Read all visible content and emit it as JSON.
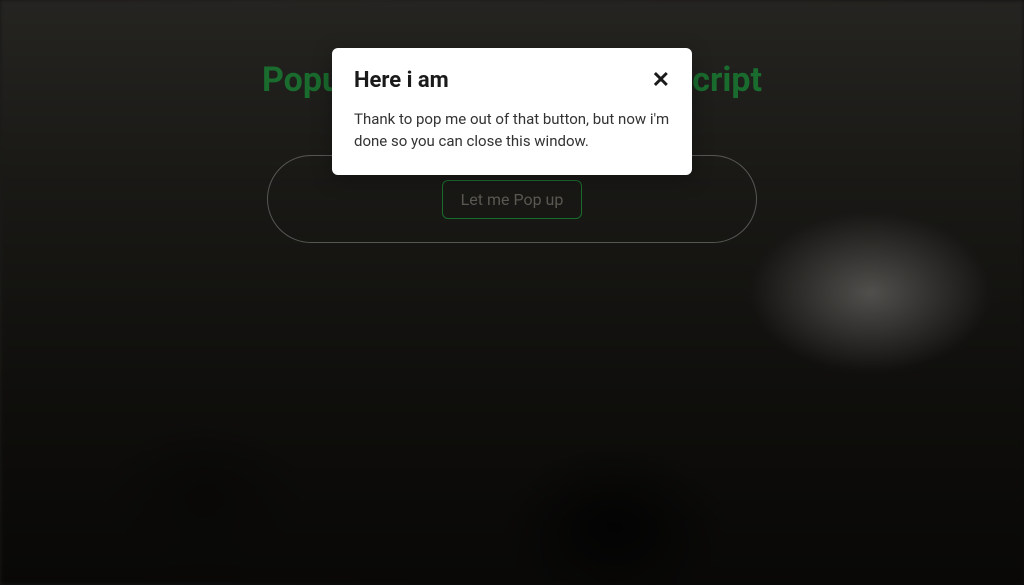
{
  "page": {
    "title": "Popup/Modal without JavaScript"
  },
  "button": {
    "label": "Let me Pop up"
  },
  "modal": {
    "title": "Here i am",
    "close_label": "✕",
    "body": "Thank to pop me out of that button, but now i'm done so you can close this window."
  }
}
